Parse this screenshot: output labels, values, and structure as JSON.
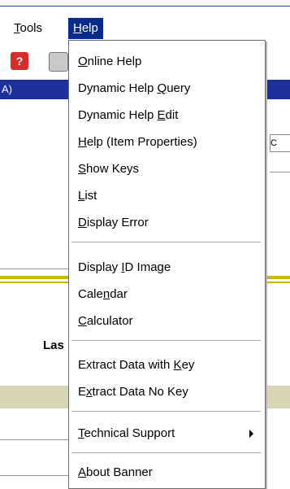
{
  "menubar": {
    "tools": {
      "label": "Tools",
      "mnemonic": "T",
      "rest": "ools"
    },
    "help": {
      "label": "Help",
      "mnemonic": "H",
      "rest": "elp"
    }
  },
  "background": {
    "bluebar_text": "A)",
    "side_text": "C",
    "las_label": "Las"
  },
  "help_menu": {
    "items": [
      {
        "pre": "",
        "u": "O",
        "post": "nline Help"
      },
      {
        "pre": "Dynamic Help ",
        "u": "Q",
        "post": "uery"
      },
      {
        "pre": "Dynamic Help ",
        "u": "E",
        "post": "dit"
      },
      {
        "pre": "",
        "u": "H",
        "post": "elp (Item Properties)"
      },
      {
        "pre": "",
        "u": "S",
        "post": "how Keys"
      },
      {
        "pre": "",
        "u": "L",
        "post": "ist"
      },
      {
        "pre": "",
        "u": "D",
        "post": "isplay Error"
      },
      {
        "pre": "Display ",
        "u": "I",
        "post": "D Image"
      },
      {
        "pre": "Cale",
        "u": "n",
        "post": "dar"
      },
      {
        "pre": "",
        "u": "C",
        "post": "alculator"
      },
      {
        "pre": "Extract Data with ",
        "u": "K",
        "post": "ey"
      },
      {
        "pre": "E",
        "u": "x",
        "post": "tract Data No Key"
      },
      {
        "pre": "",
        "u": "T",
        "post": "echnical Support"
      },
      {
        "pre": "",
        "u": "A",
        "post": "bout Banner"
      }
    ]
  },
  "colors": {
    "menu_highlight": "#0a2a8c",
    "title_bar": "#1c2f9c",
    "accent_line": "#c8b800"
  }
}
